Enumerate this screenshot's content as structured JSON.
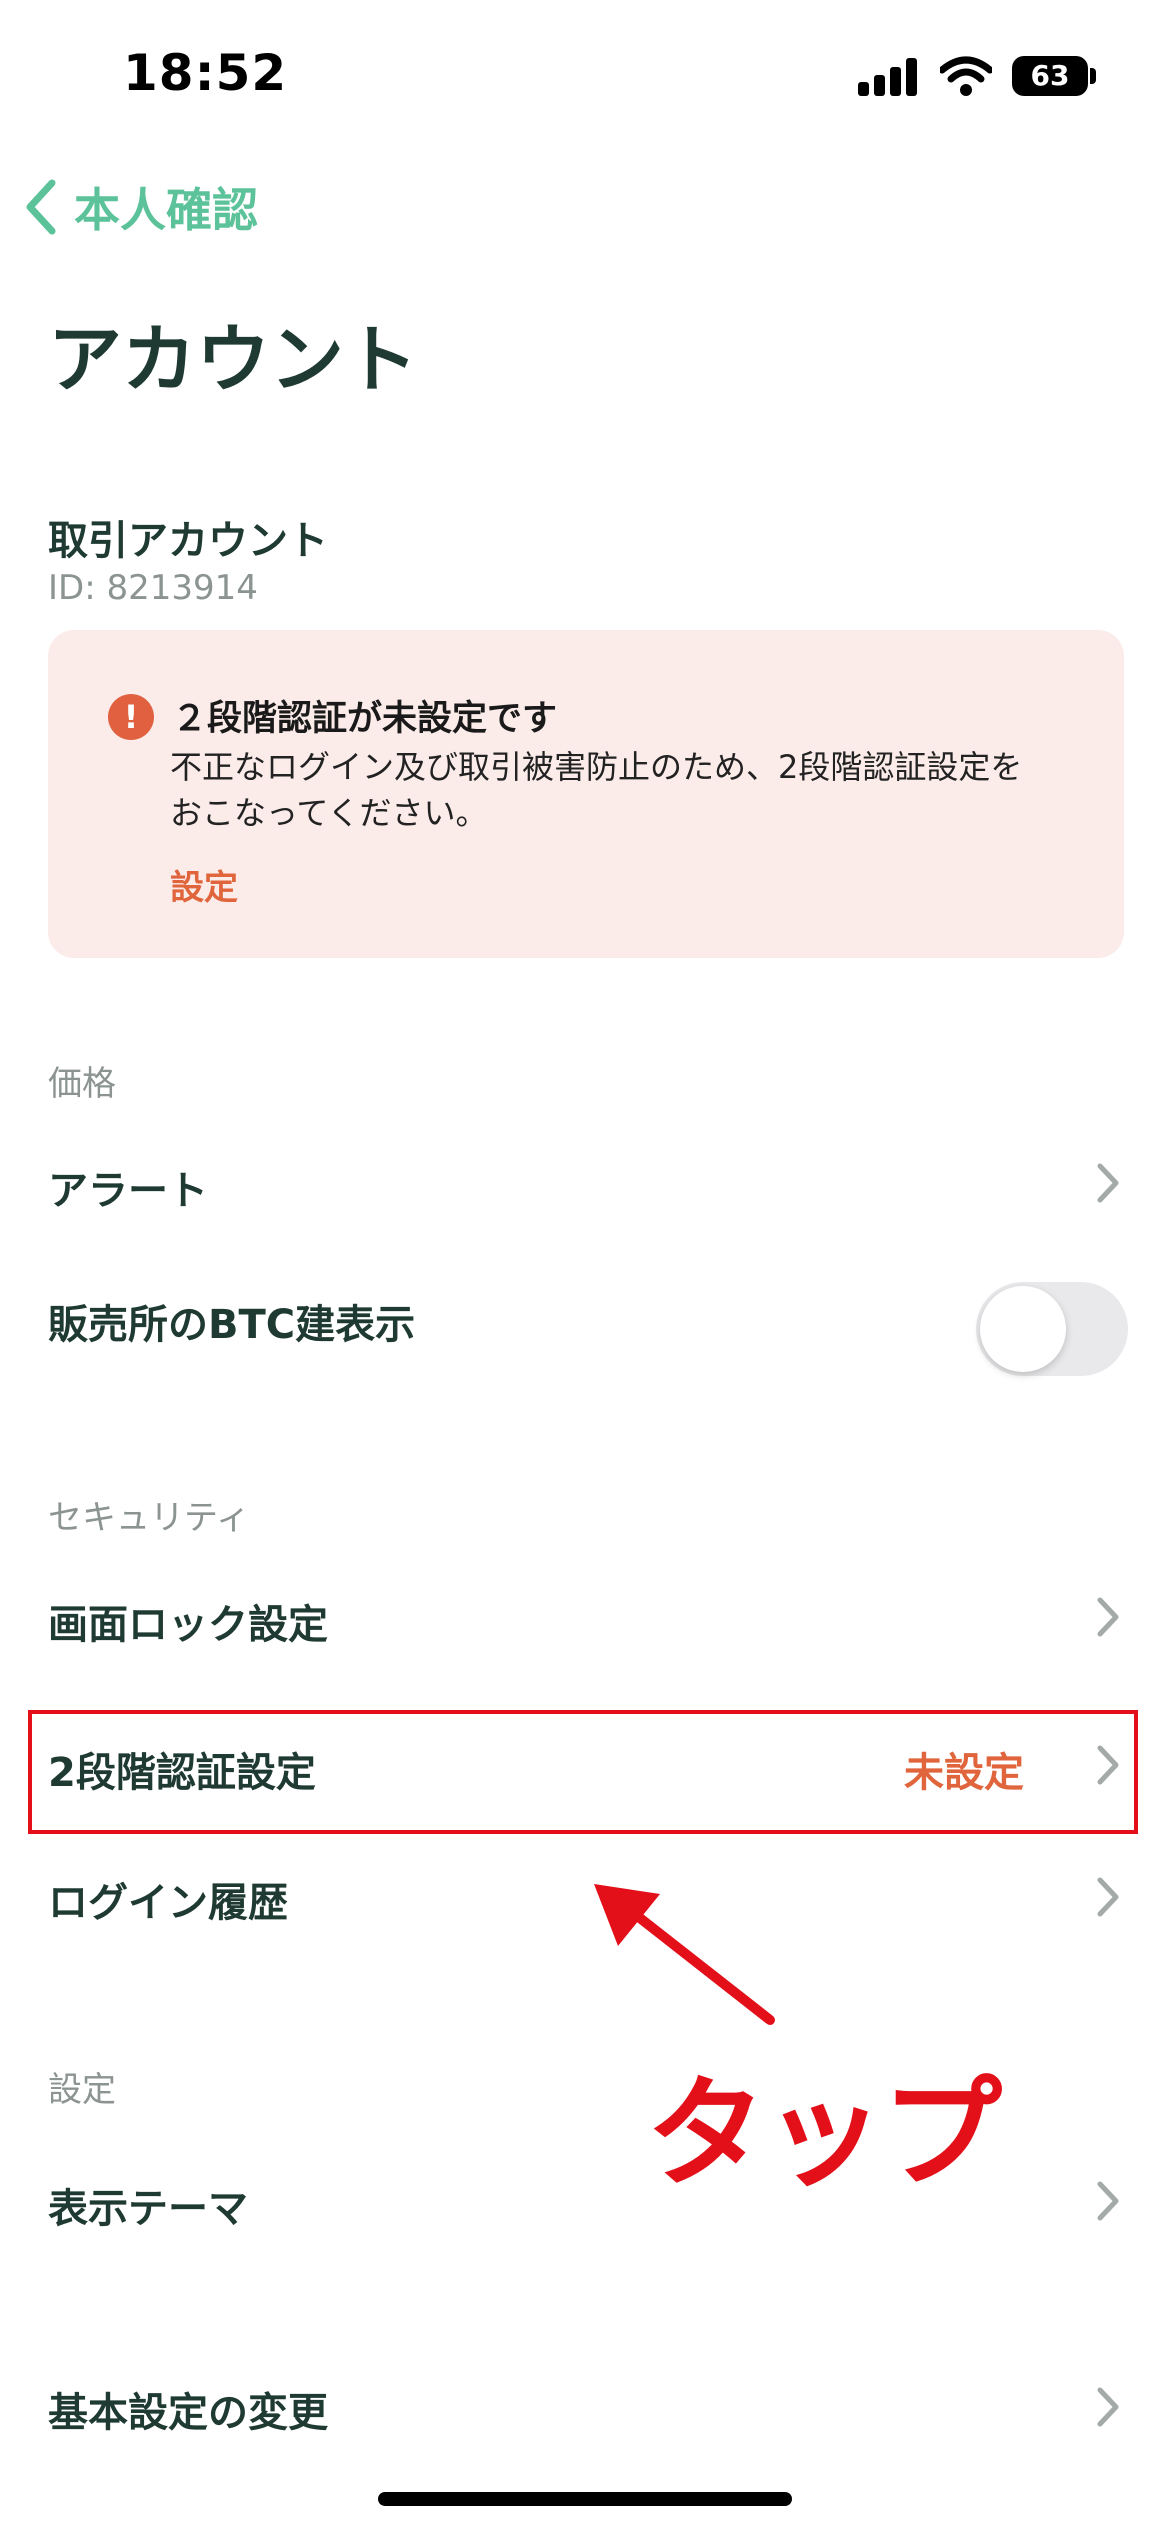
{
  "status_bar": {
    "time": "18:52",
    "battery": "63"
  },
  "nav": {
    "back_label": "本人確認"
  },
  "page": {
    "title": "アカウント"
  },
  "account": {
    "title": "取引アカウント",
    "id_text": "ID: 8213914"
  },
  "alert": {
    "icon": "!",
    "title": "２段階認証が未設定です",
    "body_line1": "不正なログイン及び取引被害防止のため、2段階認証設定を",
    "body_line2": "おこなってください。",
    "action": "設定"
  },
  "sections": {
    "price": {
      "header": "価格",
      "alert_label": "アラート",
      "btc_label": "販売所のBTC建表示",
      "btc_toggle_on": false
    },
    "security": {
      "header": "セキュリティ",
      "screen_lock_label": "画面ロック設定",
      "two_factor_label": "2段階認証設定",
      "two_factor_status": "未設定",
      "login_history_label": "ログイン履歴"
    },
    "settings": {
      "header": "設定",
      "theme_label": "表示テーマ",
      "basic_label": "基本設定の変更"
    }
  },
  "annotation": {
    "text": "タップ"
  },
  "colors": {
    "accent_green": "#5cc29a",
    "warning_orange": "#e0653c",
    "annotation_red": "#e3101a",
    "alert_bg": "#fbecea"
  },
  "icons": {
    "back": "chevron-left-icon",
    "row": "chevron-right-icon",
    "alert": "exclamation-circle-icon"
  }
}
